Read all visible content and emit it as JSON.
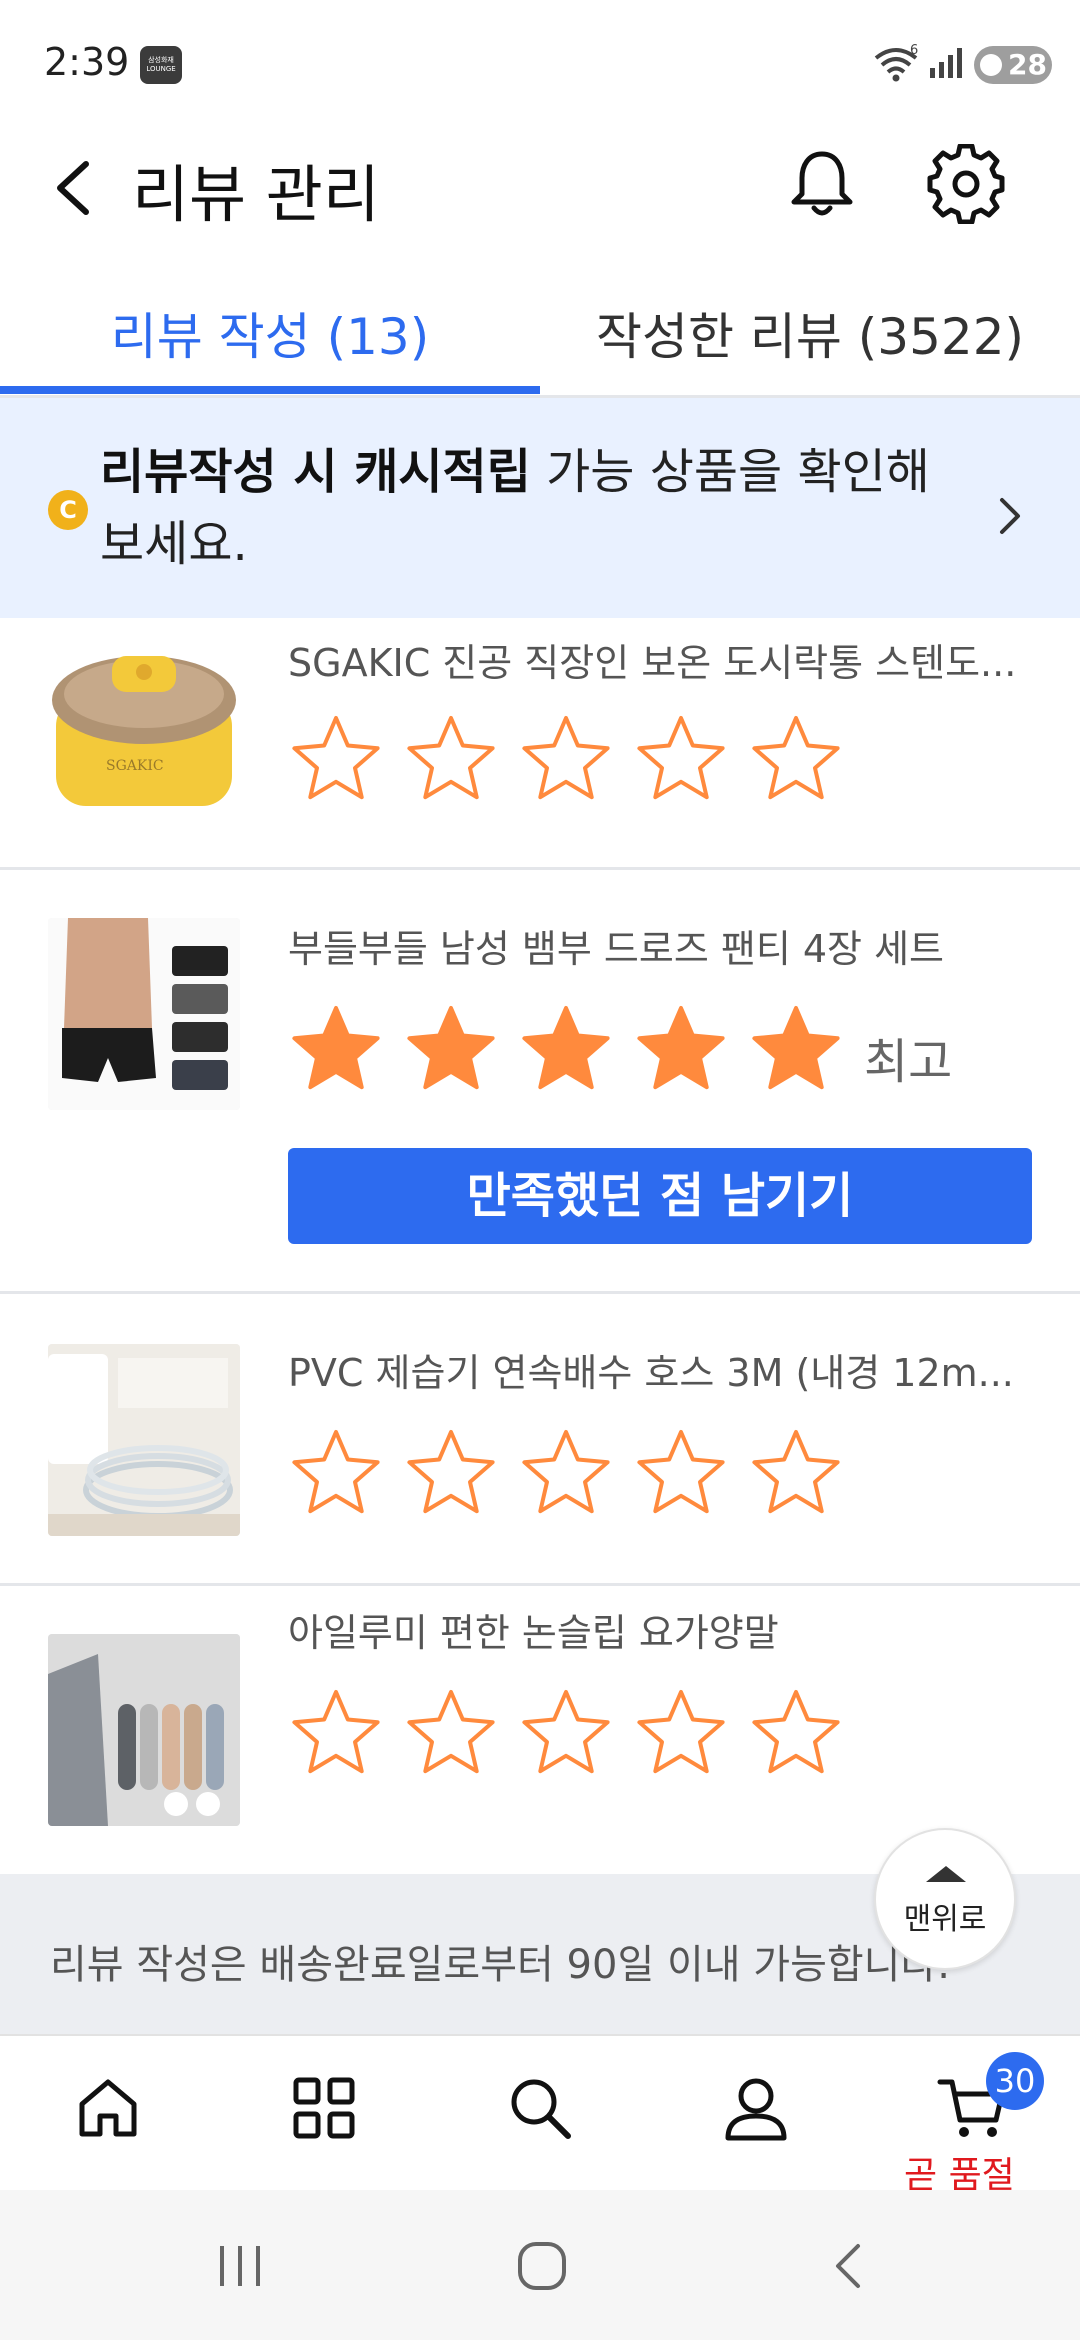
{
  "status_bar": {
    "time": "2:39",
    "lounge_badge_line1": "삼성화재",
    "lounge_badge_line2": "LOUNGE",
    "battery": "28",
    "network": "6"
  },
  "header": {
    "title": "리뷰 관리"
  },
  "tabs": [
    {
      "label": "리뷰 작성 (13)"
    },
    {
      "label": "작성한 리뷰 (3522)"
    }
  ],
  "banner": {
    "coin_letter": "C",
    "bold_text": "리뷰작성 시 캐시적립",
    "rest_text": " 가능 상품을 확인해보세요."
  },
  "products": [
    {
      "name": "SGAKIC 진공 직장인 보온 도시락통 스텐도...",
      "rating": 0
    },
    {
      "name": "부들부들 남성 뱀부 드로즈 팬티 4장 세트",
      "rating": 5,
      "rating_label": "최고",
      "action_label": "만족했던 점 남기기"
    },
    {
      "name": "PVC 제습기 연속배수 호스 3M (내경 12m...",
      "rating": 0
    },
    {
      "name": "아일루미 편한 논슬립 요가양말",
      "rating": 0
    }
  ],
  "notice": {
    "text": "리뷰 작성은 배송완료일로부터 90일 이내 가능합니다."
  },
  "scroll_top": {
    "label": "맨위로"
  },
  "bottom_nav": {
    "items": [
      "home-icon",
      "category-icon",
      "search-icon",
      "my-page-icon",
      "cart-icon"
    ],
    "cart_count": "30",
    "cart_note": "곧 품절"
  },
  "colors": {
    "accent": "#2d6bef",
    "star": "#ff8a3d",
    "banner_bg": "#e9f1ff",
    "soldout": "#e0191e"
  }
}
